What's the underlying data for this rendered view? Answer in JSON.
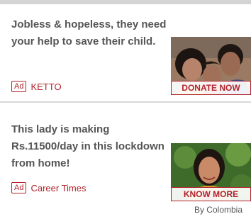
{
  "ads": [
    {
      "headline": "Jobless & hopeless, they need your help to save their child.",
      "ad_label": "Ad",
      "sponsor": "KETTO",
      "cta": "DONATE NOW",
      "image": "family-photo"
    },
    {
      "headline": "This lady is making Rs.11500/day in this lockdown from home!",
      "ad_label": "Ad",
      "sponsor": "Career Times",
      "cta": "KNOW MORE",
      "image": "woman-portrait"
    }
  ],
  "footer": {
    "attribution": "By Colombia"
  },
  "colors": {
    "accent": "#b1242c",
    "text": "#555555",
    "divider": "#d8d8d8"
  }
}
